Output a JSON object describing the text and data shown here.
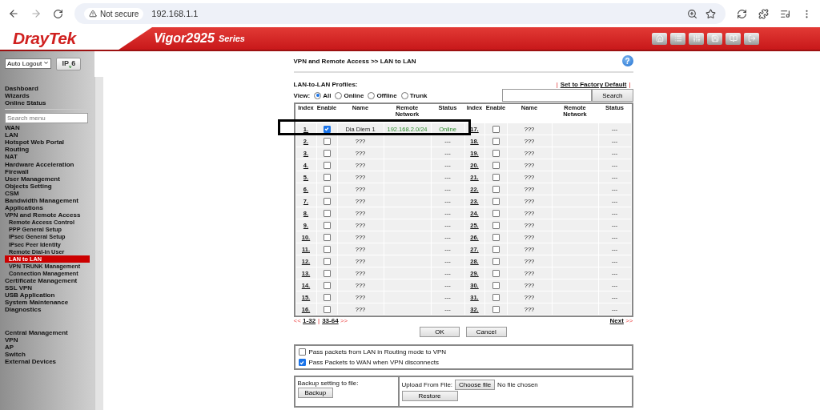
{
  "browser": {
    "security": "Not secure",
    "url": "192.168.1.1"
  },
  "header": {
    "brand": "DrayTek",
    "model": "Vigor2925",
    "series": "Series"
  },
  "sidebar": {
    "logout": "Auto Logout",
    "ipv6": "IP$_{v}$6",
    "top_items": [
      "Dashboard",
      "Wizards",
      "Online Status"
    ],
    "search": {
      "placeholder": "Search menu"
    },
    "items": [
      {
        "label": "WAN",
        "selected": false
      },
      {
        "label": "LAN",
        "selected": false
      },
      {
        "label": "Hotspot Web Portal",
        "selected": false
      },
      {
        "label": "Routing",
        "selected": false
      },
      {
        "label": "NAT",
        "selected": false
      },
      {
        "label": "Hardware Acceleration",
        "selected": false
      },
      {
        "label": "Firewall",
        "selected": false
      },
      {
        "label": "User Management",
        "selected": false
      },
      {
        "label": "Objects Setting",
        "selected": false
      },
      {
        "label": "CSM",
        "selected": false
      },
      {
        "label": "Bandwidth Management",
        "selected": false
      },
      {
        "label": "Applications",
        "selected": false
      },
      {
        "label": "VPN and Remote Access",
        "selected": false,
        "children": [
          {
            "label": "Remote Access Control",
            "selected": false
          },
          {
            "label": "PPP General Setup",
            "selected": false
          },
          {
            "label": "IPsec General Setup",
            "selected": false
          },
          {
            "label": "IPsec Peer Identity",
            "selected": false
          },
          {
            "label": "Remote Dial-in User",
            "selected": false
          },
          {
            "label": "LAN to LAN",
            "selected": true
          },
          {
            "label": "VPN TRUNK Management",
            "selected": false
          },
          {
            "label": "Connection Management",
            "selected": false
          }
        ]
      },
      {
        "label": "Certificate Management",
        "selected": false
      },
      {
        "label": "SSL VPN",
        "selected": false
      },
      {
        "label": "USB Application",
        "selected": false
      },
      {
        "label": "System Maintenance",
        "selected": false
      },
      {
        "label": "Diagnostics",
        "selected": false
      }
    ],
    "central_items": [
      {
        "label": "Central Management",
        "selected": false
      },
      {
        "label": "VPN",
        "selected": false
      },
      {
        "label": "AP",
        "selected": false
      },
      {
        "label": "Switch",
        "selected": false
      },
      {
        "label": "External Devices",
        "selected": false
      }
    ]
  },
  "main": {
    "breadcrumb": "VPN and Remote Access >> LAN to LAN",
    "help": "?",
    "profiles_title": "LAN-to-LAN Profiles:",
    "factory_default": "Set to Factory Default",
    "view_label": "View:",
    "view_options": [
      {
        "label": "All",
        "selected": true
      },
      {
        "label": "Online",
        "selected": false
      },
      {
        "label": "Offline",
        "selected": false
      },
      {
        "label": "Trunk",
        "selected": false
      }
    ],
    "search_button": "Search",
    "separator": "|",
    "columns": [
      "Index",
      "Enable",
      "Name",
      "Remote Network",
      "Status",
      "Index",
      "Enable",
      "Name",
      "Remote Network",
      "Status"
    ],
    "profiles": [
      {
        "index": "1.",
        "enabled": true,
        "name": "Dia Diem 1",
        "remote_network": "192.168.2.0/24",
        "status": "Online"
      },
      {
        "index": "2.",
        "enabled": false,
        "name": "???",
        "status": "---"
      },
      {
        "index": "3.",
        "enabled": false,
        "name": "???",
        "status": "---"
      },
      {
        "index": "4.",
        "enabled": false,
        "name": "???",
        "status": "---"
      },
      {
        "index": "5.",
        "enabled": false,
        "name": "???",
        "status": "---"
      },
      {
        "index": "6.",
        "enabled": false,
        "name": "???",
        "status": "---"
      },
      {
        "index": "7.",
        "enabled": false,
        "name": "???",
        "status": "---"
      },
      {
        "index": "8.",
        "enabled": false,
        "name": "???",
        "status": "---"
      },
      {
        "index": "9.",
        "enabled": false,
        "name": "???",
        "status": "---"
      },
      {
        "index": "10.",
        "enabled": false,
        "name": "???",
        "status": "---"
      },
      {
        "index": "11.",
        "enabled": false,
        "name": "???",
        "status": "---"
      },
      {
        "index": "12.",
        "enabled": false,
        "name": "???",
        "status": "---"
      },
      {
        "index": "13.",
        "enabled": false,
        "name": "???",
        "status": "---"
      },
      {
        "index": "14.",
        "enabled": false,
        "name": "???",
        "status": "---"
      },
      {
        "index": "15.",
        "enabled": false,
        "name": "???",
        "status": "---"
      },
      {
        "index": "16.",
        "enabled": false,
        "name": "???",
        "status": "---"
      },
      {
        "index": "17.",
        "enabled": false,
        "name": "???",
        "status": "---"
      },
      {
        "index": "18.",
        "enabled": false,
        "name": "???",
        "status": "---"
      },
      {
        "index": "19.",
        "enabled": false,
        "name": "???",
        "status": "---"
      },
      {
        "index": "20.",
        "enabled": false,
        "name": "???",
        "status": "---"
      },
      {
        "index": "21.",
        "enabled": false,
        "name": "???",
        "status": "---"
      },
      {
        "index": "22.",
        "enabled": false,
        "name": "???",
        "status": "---"
      },
      {
        "index": "23.",
        "enabled": false,
        "name": "???",
        "status": "---"
      },
      {
        "index": "24.",
        "enabled": false,
        "name": "???",
        "status": "---"
      },
      {
        "index": "25.",
        "enabled": false,
        "name": "???",
        "status": "---"
      },
      {
        "index": "26.",
        "enabled": false,
        "name": "???",
        "status": "---"
      },
      {
        "index": "27.",
        "enabled": false,
        "name": "???",
        "status": "---"
      },
      {
        "index": "28.",
        "enabled": false,
        "name": "???",
        "status": "---"
      },
      {
        "index": "29.",
        "enabled": false,
        "name": "???",
        "status": "---"
      },
      {
        "index": "30.",
        "enabled": false,
        "name": "???",
        "status": "---"
      },
      {
        "index": "31.",
        "enabled": false,
        "name": "???",
        "status": "---"
      },
      {
        "index": "32.",
        "enabled": false,
        "name": "???",
        "status": "---"
      }
    ],
    "pagination": {
      "prev": "<<",
      "pages": [
        "1-32",
        "33-64"
      ],
      "next_arrows": ">>",
      "next": "Next",
      "next_mark": ">>"
    },
    "buttons": [
      "OK",
      "Cancel"
    ],
    "options": [
      {
        "label": "Pass packets from LAN in Routing mode to VPN",
        "checked": false
      },
      {
        "label": "Pass Packets to WAN when VPN disconnects",
        "checked": true
      }
    ],
    "backup": {
      "label": "Backup setting to file:",
      "button": "Backup"
    },
    "restore": {
      "label": "Upload From File:",
      "choose": "Choose file",
      "file": "No file chosen",
      "button": "Restore"
    }
  }
}
